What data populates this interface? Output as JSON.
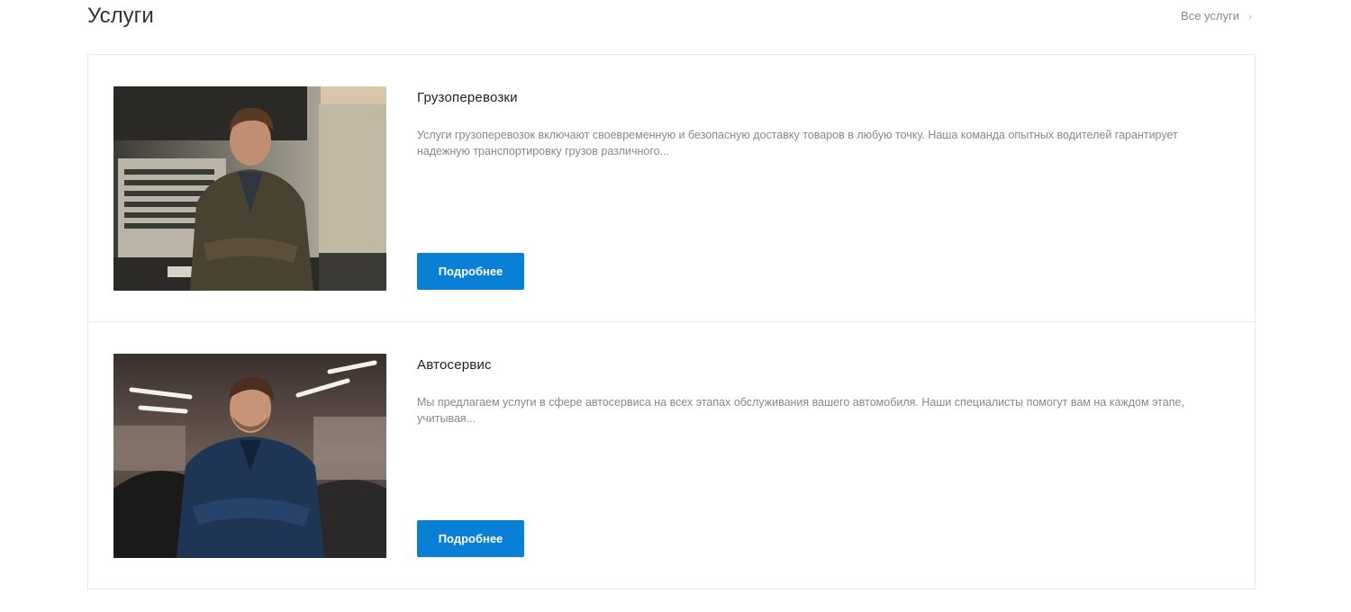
{
  "section": {
    "title": "Услуги",
    "all_link": "Все услуги",
    "all_link_icon": "chevron-right-icon"
  },
  "services": [
    {
      "title": "Грузоперевозки",
      "description": "Услуги грузоперевозок включают своевременную и безопасную доставку товаров в любую точку. Наша команда опытных водителей гарантирует надежную транспортировку грузов различного...",
      "button": "Подробнее",
      "image": "truck-driver-photo"
    },
    {
      "title": "Автосервис",
      "description": "Мы предлагаем услуги в сфере автосервиса на всех этапах обслуживания вашего автомобиля. Наши специалисты помогут вам на каждом этапе, учитывая...",
      "button": "Подробнее",
      "image": "mechanic-photo"
    }
  ],
  "colors": {
    "accent": "#0a7fd6",
    "border": "#e8e8e8",
    "muted_text": "#888888"
  }
}
